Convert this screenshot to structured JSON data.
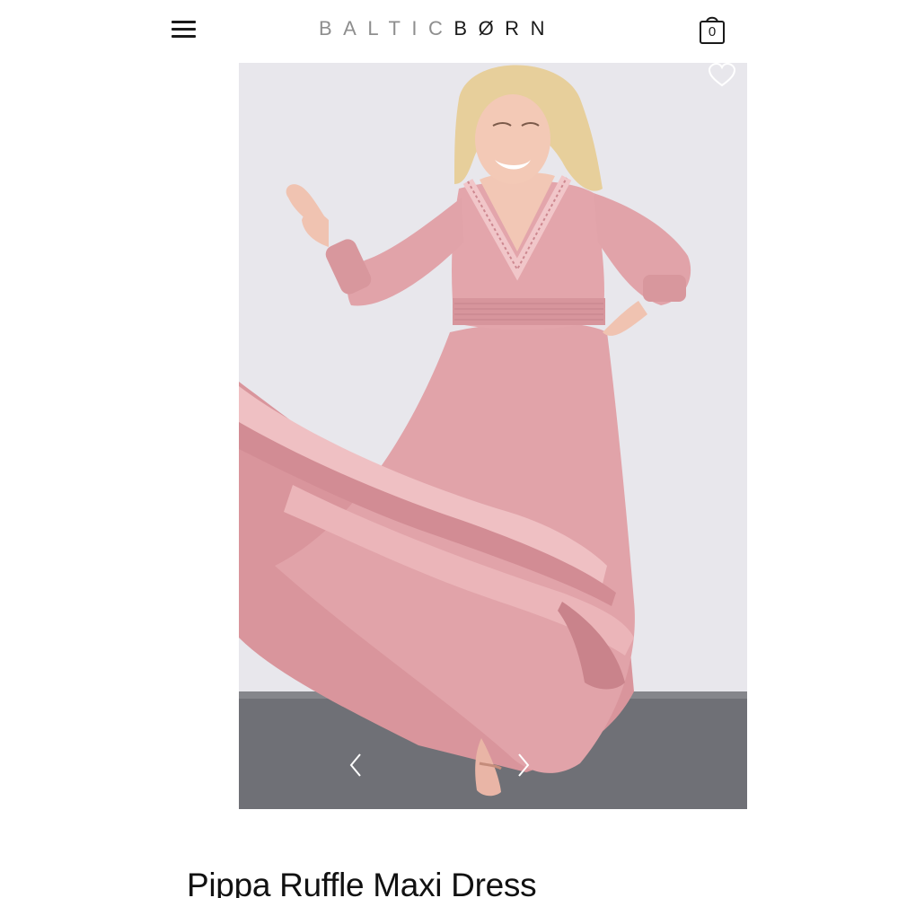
{
  "header": {
    "logo_left": "BALTIC",
    "logo_right": "BØRN",
    "cart_count": "0"
  },
  "icons": {
    "menu": "hamburger-menu-icon",
    "cart": "shopping-bag-icon",
    "wishlist": "heart-icon",
    "prev": "chevron-left-icon",
    "next": "chevron-right-icon"
  },
  "product": {
    "title": "Pippa Ruffle Maxi Dress",
    "dress_color": "#e0a0a6",
    "background_wall": "#e8e7ec",
    "floor_color": "#6f7076"
  }
}
